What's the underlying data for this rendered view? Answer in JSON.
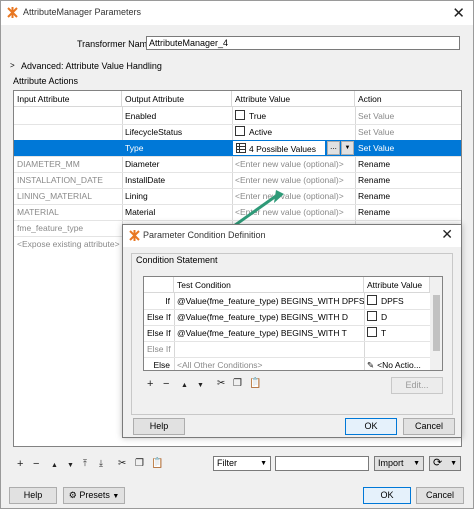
{
  "window": {
    "title": "AttributeManager Parameters",
    "transformer_name_label": "Transformer Name:",
    "transformer_name_value": "AttributeManager_4",
    "advanced_label": "Advanced: Attribute Value Handling",
    "attribute_actions_label": "Attribute Actions"
  },
  "main_table": {
    "headers": [
      "Input Attribute",
      "Output Attribute",
      "Attribute Value",
      "Action"
    ],
    "rows": [
      {
        "input": "",
        "output": "Enabled",
        "value": "True",
        "action": "Set Value",
        "value_gray": false,
        "action_gray": true
      },
      {
        "input": "",
        "output": "LifecycleStatus",
        "value": "Active",
        "action": "Set Value",
        "value_gray": false,
        "action_gray": true
      },
      {
        "input": "",
        "output": "Type",
        "value": "4 Possible Values",
        "action": "Set Value",
        "value_gray": false,
        "action_gray": false
      },
      {
        "input": "DIAMETER_MM",
        "output": "Diameter",
        "value": "<Enter new value (optional)>",
        "action": "Rename",
        "value_gray": true,
        "action_gray": false
      },
      {
        "input": "INSTALLATION_DATE",
        "output": "InstallDate",
        "value": "<Enter new value (optional)>",
        "action": "Rename",
        "value_gray": true,
        "action_gray": false
      },
      {
        "input": "LINING_MATERIAL",
        "output": "Lining",
        "value": "<Enter new value (optional)>",
        "action": "Rename",
        "value_gray": true,
        "action_gray": false
      },
      {
        "input": "MATERIAL",
        "output": "Material",
        "value": "<Enter new value (optional)>",
        "action": "Rename",
        "value_gray": true,
        "action_gray": false
      },
      {
        "input": "fme_feature_type",
        "output": "",
        "value": "",
        "action": "",
        "value_gray": false,
        "action_gray": false
      },
      {
        "input": "<Expose existing attribute>",
        "output": "",
        "value": "",
        "action": "",
        "value_gray": false,
        "action_gray": false
      }
    ],
    "ellipsis": "...",
    "dropdown_arrow": "▼"
  },
  "bottom_bar": {
    "filter_placeholder": "Filter",
    "import_label": "Import",
    "help_label": "Help",
    "presets_label": "Presets",
    "ok_label": "OK",
    "cancel_label": "Cancel"
  },
  "dialog": {
    "title": "Parameter Condition Definition",
    "section_label": "Condition Statement",
    "headers": [
      "Test Condition",
      "Attribute Value"
    ],
    "rows": [
      {
        "prefix": "If",
        "condition": "@Value(fme_feature_type) BEGINS_WITH DPFS",
        "value": "DPFS",
        "cond_gray": false
      },
      {
        "prefix": "Else If",
        "condition": "@Value(fme_feature_type) BEGINS_WITH D",
        "value": "D",
        "cond_gray": false
      },
      {
        "prefix": "Else If",
        "condition": "@Value(fme_feature_type) BEGINS_WITH T",
        "value": "T",
        "cond_gray": false
      },
      {
        "prefix": "Else If",
        "condition": "",
        "value": "",
        "cond_gray": true
      },
      {
        "prefix": "Else",
        "condition": "<All Other Conditions>",
        "value": "<No Actio...",
        "cond_gray": true
      }
    ],
    "edit_label": "Edit...",
    "help_label": "Help",
    "ok_label": "OK",
    "cancel_label": "Cancel"
  },
  "colors": {
    "selection": "#0078d7",
    "arrow": "#2e9a78"
  }
}
